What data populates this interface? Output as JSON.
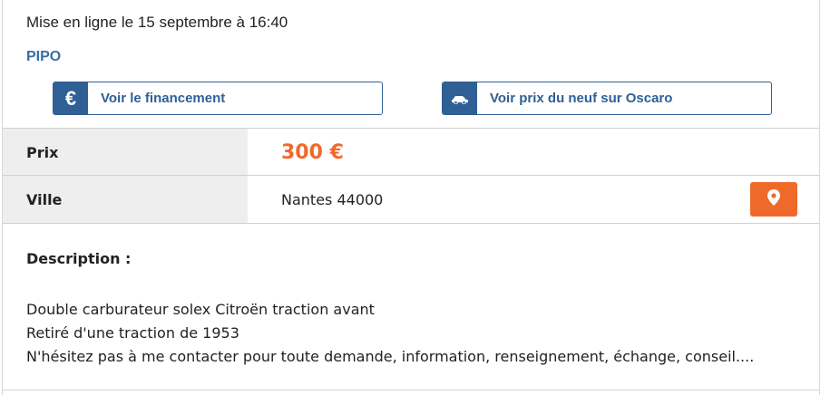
{
  "listing": {
    "posted": "Mise en ligne le 15 septembre à 16:40",
    "seller": "PIPO"
  },
  "actions": {
    "financing_label": "Voir le financement",
    "financing_icon": "euro-icon",
    "oscaro_label": "Voir prix du neuf sur Oscaro",
    "oscaro_icon": "car-icon"
  },
  "details": {
    "price_label": "Prix",
    "price_value": "300 €",
    "city_label": "Ville",
    "city_value": "Nantes 44000",
    "map_icon": "map-pin-icon"
  },
  "description": {
    "title": "Description :",
    "lines": [
      "Double carburateur solex Citroën traction avant",
      "Retiré d'une traction de 1953",
      "N'hésitez pas à me contacter pour toute demande, information, renseignement, échange, conseil...."
    ]
  },
  "colors": {
    "accent_blue": "#2f5f95",
    "accent_orange": "#ef6a2a",
    "label_bg": "#eeeeee"
  }
}
